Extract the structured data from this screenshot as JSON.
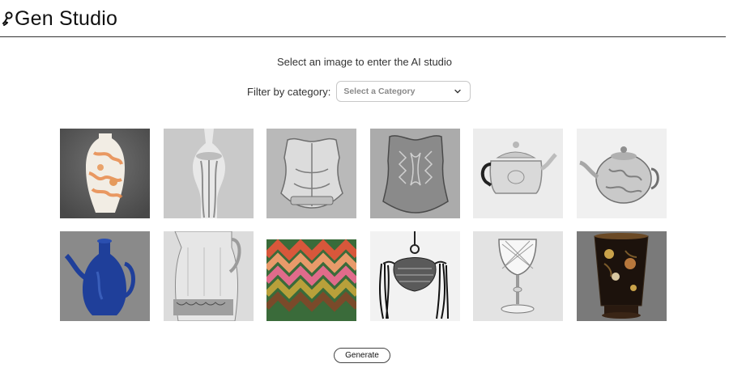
{
  "header": {
    "title": "Gen Studio",
    "logo_icon": "genie-lamp-icon"
  },
  "instruction": "Select an image to enter the AI studio",
  "filter": {
    "label": "Filter by category:",
    "placeholder": "Select a Category",
    "icon": "chevron-down-icon"
  },
  "gallery": {
    "items": [
      {
        "subject": "porcelain-vase",
        "background": "#5f5f5f"
      },
      {
        "subject": "silver-ewer-detail",
        "background": "#c9c9c9"
      },
      {
        "subject": "breastplate-armor",
        "background": "#b9b9b9"
      },
      {
        "subject": "etched-breastplate",
        "background": "#9a9a9a"
      },
      {
        "subject": "silver-teapot",
        "background": "#ececec"
      },
      {
        "subject": "silver-teapot-round",
        "background": "#f0f0f0"
      },
      {
        "subject": "blue-ewer",
        "background": "#8a8a8a"
      },
      {
        "subject": "silver-pitcher",
        "background": "#dcdcdc"
      },
      {
        "subject": "zigzag-textile",
        "background": "#3a6b3a"
      },
      {
        "subject": "tasseled-pouch",
        "background": "#f2f2f2"
      },
      {
        "subject": "cut-glass-goblet",
        "background": "#e3e3e3"
      },
      {
        "subject": "lacquer-beaker",
        "background": "#7a7a7a"
      }
    ]
  },
  "actions": {
    "generate_label": "Generate"
  }
}
